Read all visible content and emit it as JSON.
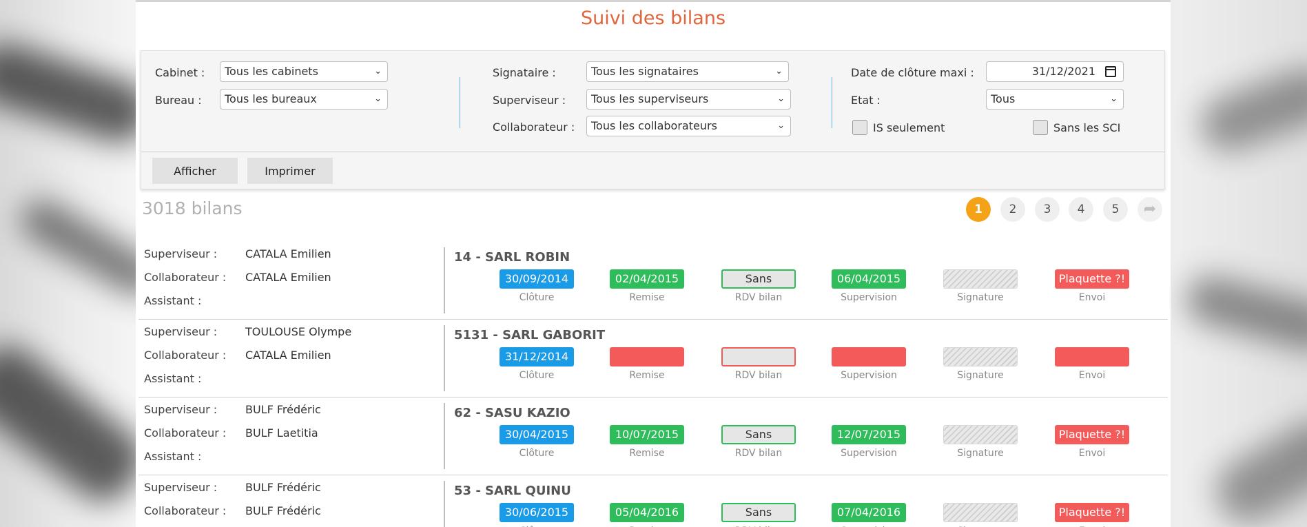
{
  "page": {
    "title": "Suivi des bilans"
  },
  "filters": {
    "cabinet": {
      "label": "Cabinet :",
      "value": "Tous les cabinets"
    },
    "bureau": {
      "label": "Bureau :",
      "value": "Tous les bureaux"
    },
    "signataire": {
      "label": "Signataire :",
      "value": "Tous les signataires"
    },
    "superviseur": {
      "label": "Superviseur :",
      "value": "Tous les superviseurs"
    },
    "collaborateur": {
      "label": "Collaborateur :",
      "value": "Tous les collaborateurs"
    },
    "date_cloture": {
      "label": "Date de clôture maxi :",
      "value": "31/12/2021"
    },
    "etat": {
      "label": "Etat :",
      "value": "Tous"
    },
    "is_seulement": {
      "label": "IS seulement",
      "checked": false
    },
    "sans_sci": {
      "label": "Sans les SCI",
      "checked": false
    }
  },
  "actions": {
    "afficher": "Afficher",
    "imprimer": "Imprimer"
  },
  "summary": {
    "count": "3018 bilans"
  },
  "pagination": {
    "pages": [
      "1",
      "2",
      "3",
      "4",
      "5"
    ],
    "current": "1",
    "next_icon": "share-arrow-icon"
  },
  "labels": {
    "superviseur": "Superviseur  :",
    "collaborateur": "Collaborateur :",
    "assistant": "Assistant :",
    "captions": [
      "Clôture",
      "Remise",
      "RDV bilan",
      "Supervision",
      "Signature",
      "Envoi"
    ]
  },
  "records": [
    {
      "superviseur": "CATALA Emilien",
      "collaborateur": "CATALA Emilien",
      "assistant": "",
      "name": "14 - SARL ROBIN",
      "cloture": "30/09/2014",
      "remise": "02/04/2015",
      "rdv": "Sans",
      "supervision": "06/04/2015",
      "signature": "",
      "envoi": "Plaquette ?!"
    },
    {
      "superviseur": "TOULOUSE Olympe",
      "collaborateur": "CATALA Emilien",
      "assistant": "",
      "name": "5131 - SARL GABORIT",
      "cloture": "31/12/2014",
      "remise": "",
      "rdv": "",
      "supervision": "",
      "signature": "",
      "envoi": ""
    },
    {
      "superviseur": "BULF Frédéric",
      "collaborateur": "BULF Laetitia",
      "assistant": "",
      "name": "62 - SASU KAZIO",
      "cloture": "30/04/2015",
      "remise": "10/07/2015",
      "rdv": "Sans",
      "supervision": "12/07/2015",
      "signature": "",
      "envoi": "Plaquette ?!"
    },
    {
      "superviseur": "BULF Frédéric",
      "collaborateur": "BULF Frédéric",
      "assistant": "",
      "name": "53 - SARL QUINU",
      "cloture": "30/06/2015",
      "remise": "05/04/2016",
      "rdv": "Sans",
      "supervision": "07/04/2016",
      "signature": "",
      "envoi": "Plaquette ?!"
    }
  ],
  "colors": {
    "accent": "#e0653a",
    "blue": "#1a9be8",
    "green": "#2ebd5a",
    "red": "#f35b5b",
    "active_page": "#f4a319"
  }
}
